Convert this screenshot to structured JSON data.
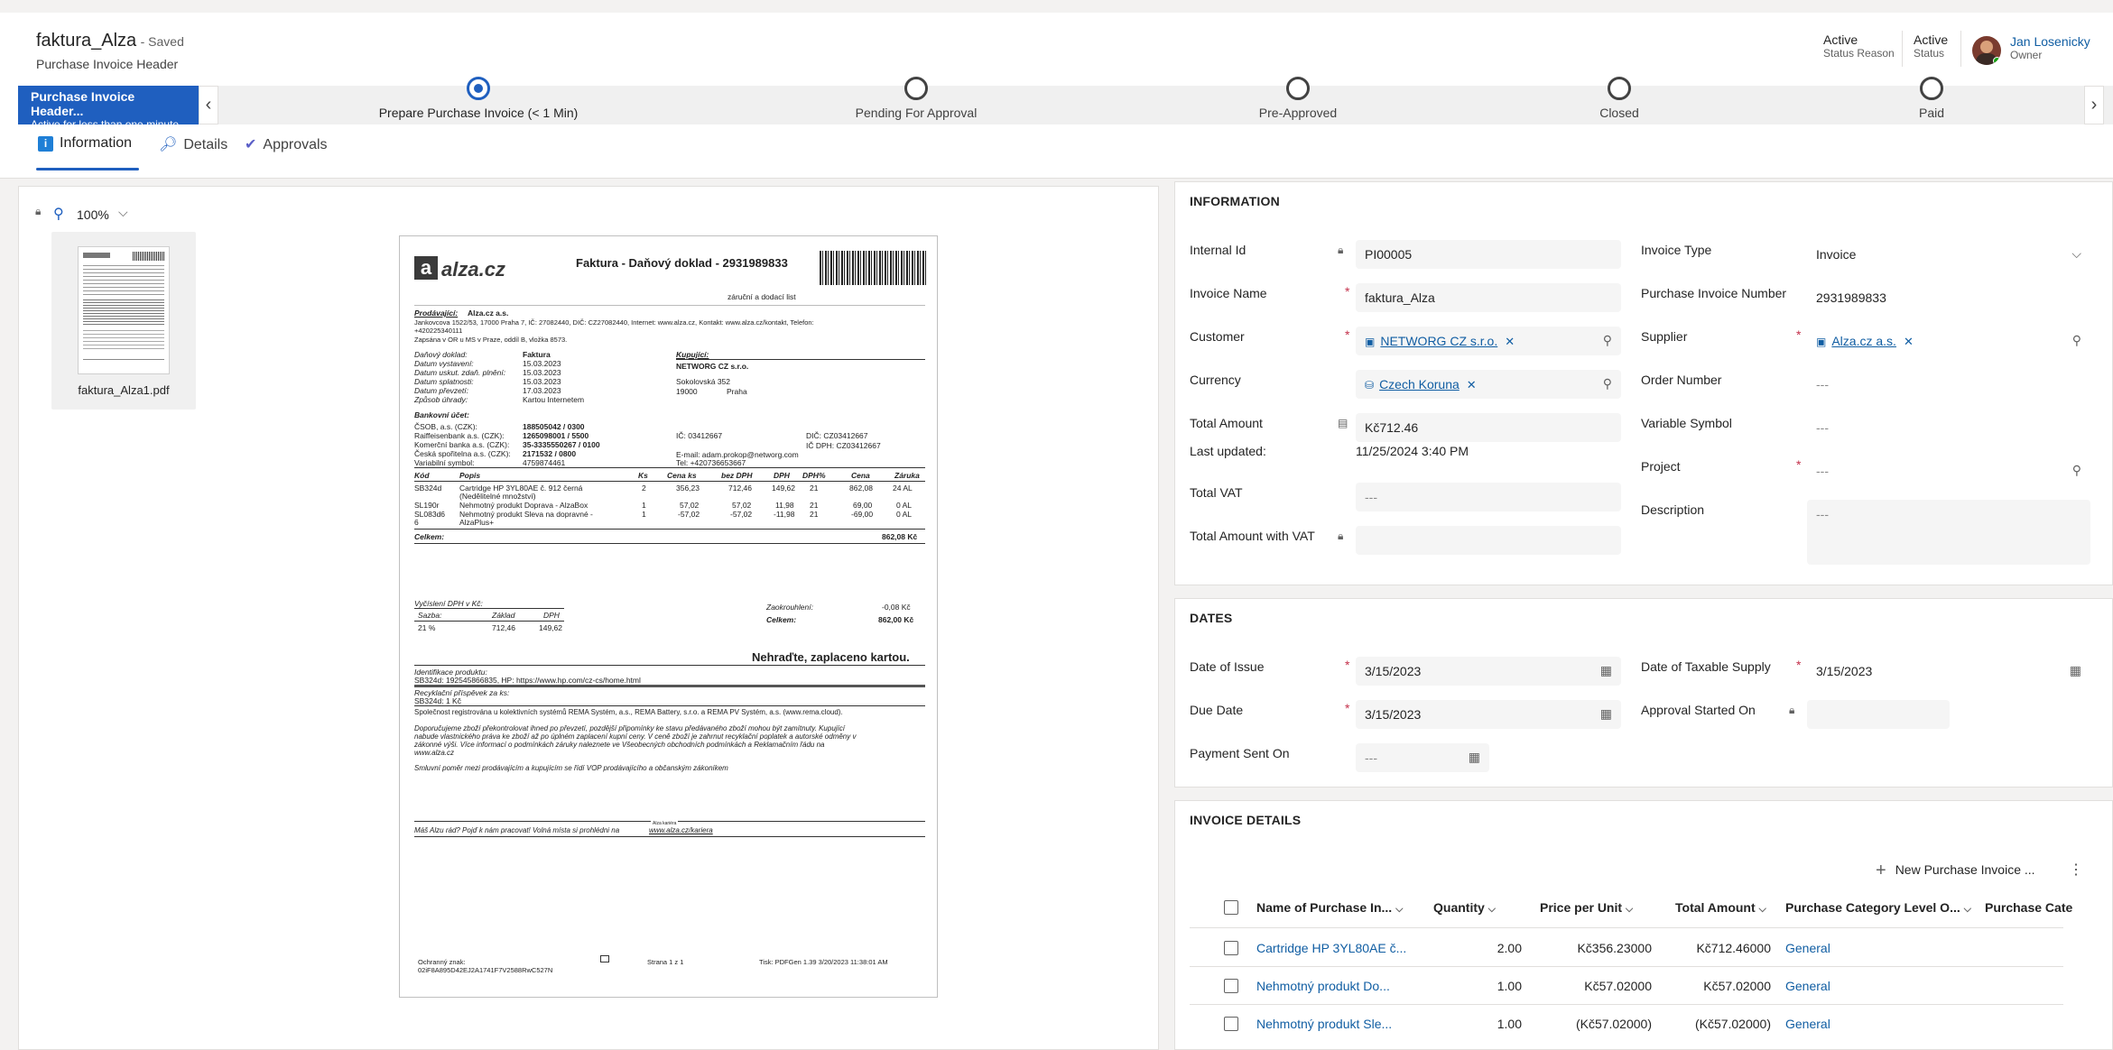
{
  "header": {
    "title": "faktura_Alza",
    "saved": "- Saved",
    "entity": "Purchase Invoice Header",
    "status_reason_value": "Active",
    "status_reason_label": "Status Reason",
    "status_value": "Active",
    "status_label": "Status",
    "owner_name": "Jan Losenicky",
    "owner_label": "Owner"
  },
  "bpf": {
    "active_title": "Purchase Invoice Header...",
    "active_sub": "Active for less than one minute",
    "stages": [
      "Prepare Purchase Invoice  (< 1 Min)",
      "Pending For Approval",
      "Pre-Approved",
      "Closed",
      "Paid"
    ]
  },
  "tabs": [
    "Information",
    "Details",
    "Approvals"
  ],
  "viewer": {
    "zoom": "100%",
    "file_name": "faktura_Alza1.pdf"
  },
  "document": {
    "logo": "alza.cz",
    "heading": "Faktura - Daňový doklad - 2931989833",
    "subheading": "záruční a dodací list",
    "seller_label": "Prodávající:",
    "seller_name": "Alza.cz a.s.",
    "seller_addr": "Jankovcova 1522/53, 17000 Praha 7, IČ: 27082440, DIČ: CZ27082440, Internet: www.alza.cz, Kontakt: www.alza.cz/kontakt, Telefon:",
    "seller_phone": "+420225340111",
    "seller_reg": "Zapsána v OR u MS v Praze, oddíl B, vložka 8573.",
    "tax_doc_label": "Daňový doklad:",
    "tax_doc_value": "Faktura",
    "date_issue_label": "Datum vystavení:",
    "date_issue_value": "15.03.2023",
    "date_tax_label": "Datum uskut. zdaň. plnění:",
    "date_tax_value": "15.03.2023",
    "date_due_label": "Datum splatnosti:",
    "date_due_value": "15.03.2023",
    "date_take_label": "Datum převzetí:",
    "date_take_value": "17.03.2023",
    "pay_label": "Způsob úhrady:",
    "pay_value": "Kartou Internetem",
    "buyer_label": "Kupující:",
    "buyer_name": "NETWORG CZ s.r.o.",
    "buyer_street": "Sokolovská 352",
    "buyer_zip": "19000",
    "buyer_city": "Praha",
    "bank_label": "Bankovní účet:",
    "bank1_label": "ČSOB, a.s. (CZK):",
    "bank1_value": "188505042 / 0300",
    "bank2_label": "Raiffeisenbank a.s. (CZK):",
    "bank2_value": "1265098001 / 5500",
    "bank3_label": "Komerční banka a.s. (CZK):",
    "bank3_value": "35-3335550267 / 0100",
    "bank4_label": "Česká spořitelna a.s. (CZK):",
    "bank4_value": "2171532 / 0800",
    "vs_label": "Variabilní symbol:",
    "vs_value": "4759874461",
    "buyer_ic": "IČ: 03412667",
    "buyer_dic": "DIČ: CZ03412667",
    "buyer_icdph": "IČ DPH: CZ03412667",
    "buyer_email": "E-mail: adam.prokop@networg.com",
    "buyer_tel": "Tel: +420736653667",
    "cols": [
      "Kód",
      "Popis",
      "Ks",
      "Cena ks",
      "bez DPH",
      "DPH",
      "DPH%",
      "Cena",
      "Záruka"
    ],
    "rows": [
      [
        "SB324d",
        "Cartridge HP 3YL80AE č. 912 černá",
        "2",
        "356,23",
        "712,46",
        "149,62",
        "21",
        "862,08",
        "24 AL"
      ],
      [
        "",
        "(Nedělitelné množství)",
        "",
        "",
        "",
        "",
        "",
        "",
        ""
      ],
      [
        "SL190r",
        "Nehmotný produkt Doprava - AlzaBox",
        "1",
        "57,02",
        "57,02",
        "11,98",
        "21",
        "69,00",
        "0 AL"
      ],
      [
        "SL083d6",
        "Nehmotný produkt Sleva na dopravné -",
        "1",
        "-57,02",
        "-57,02",
        "-11,98",
        "21",
        "-69,00",
        "0 AL"
      ],
      [
        "6",
        "AlzaPlus+",
        "",
        "",
        "",
        "",
        "",
        "",
        ""
      ]
    ],
    "total_label": "Celkem:",
    "total_value": "862,08  Kč",
    "vat_title": "Vyčíslení DPH v Kč:",
    "vat_cols": [
      "Sazba:",
      "Základ",
      "DPH"
    ],
    "vat_row": [
      "21 %",
      "712,46",
      "149,62"
    ],
    "round_label": "Zaokrouhlení:",
    "round_value": "-0,08  Kč",
    "sum_label": "Celkem:",
    "sum_value": "862,00  Kč",
    "paid_note": "Nehraďte, zaplaceno kartou.",
    "prod_id_label": "Identifikace produktu:",
    "prod_id_value": "SB324d: 192545866835, HP: https://www.hp.com/cz-cs/home.html",
    "recycle_label": "Recyklační příspěvek za ks:",
    "recycle_value": "SB324d:              1 Kč",
    "rema": "Společnost registrována u kolektivních systémů REMA Systém, a.s., REMA Battery, s.r.o. a REMA PV Systém, a.s. (www.rema.cloud).",
    "advice1": "Doporučujeme zboží překontrolovat ihned po převzetí, pozdější připomínky ke stavu předávaného zboží mohou být zamítnuty. Kupující",
    "advice2": "nabude vlastnického práva ke zboží až po úplném zaplacení kupní ceny. V ceně zboží je zahrnut recyklační poplatek a autorské odměny v",
    "advice3": "zákonné výši. Více informací o podmínkách záruky naleznete ve Všeobecných obchodních podmínkách a Reklamačním řádu na",
    "advice4": "www.alza.cz",
    "contract": "Smluvní poměr mezi prodávajícím a kupujícím se řídí VOP prodávajícího a občanským zákoníkem",
    "career_small": "Alza kariéra",
    "career": "Máš Alzu rád? Pojď k nám pracovat! Volná místa si prohlédni na",
    "career_link": "www.alza.cz/kariera",
    "stamp_label": "Ochranný znak:",
    "stamp_value": "02iF8A895D42EJ2A1741F7V2588RwC527N",
    "page": "Strana 1 z 1",
    "printed": "Tisk: PDFGen 1.39  3/20/2023 11:38:01 AM"
  },
  "information": {
    "title": "INFORMATION",
    "internal_id_label": "Internal Id",
    "internal_id": "PI00005",
    "invoice_name_label": "Invoice Name",
    "invoice_name": "faktura_Alza",
    "customer_label": "Customer",
    "customer": "NETWORG CZ s.r.o.",
    "currency_label": "Currency",
    "currency": "Czech Koruna",
    "total_amount_label": "Total Amount",
    "total_amount": "Kč712.46",
    "last_updated_label": "Last updated:",
    "last_updated": "11/25/2024 3:40 PM",
    "total_vat_label": "Total VAT",
    "total_vat": "---",
    "total_with_vat_label": "Total Amount with VAT",
    "total_with_vat": "",
    "invoice_type_label": "Invoice Type",
    "invoice_type": "Invoice",
    "pin_label": "Purchase Invoice Number",
    "pin": "2931989833",
    "supplier_label": "Supplier",
    "supplier": "Alza.cz a.s.",
    "order_label": "Order Number",
    "order": "---",
    "vs_label": "Variable Symbol",
    "vs": "---",
    "project_label": "Project",
    "project": "---",
    "desc_label": "Description",
    "desc": "---"
  },
  "dates": {
    "title": "DATES",
    "issue_label": "Date of Issue",
    "issue": "3/15/2023",
    "due_label": "Due Date",
    "due": "3/15/2023",
    "sent_label": "Payment Sent On",
    "sent": "---",
    "taxable_label": "Date of Taxable Supply",
    "taxable": "3/15/2023",
    "approval_label": "Approval Started On",
    "approval": ""
  },
  "details": {
    "title": "INVOICE DETAILS",
    "new_btn": "New Purchase Invoice ...",
    "cols": [
      "Name of Purchase In...",
      "Quantity",
      "Price per Unit",
      "Total Amount",
      "Purchase Category Level O...",
      "Purchase Cate"
    ],
    "rows": [
      {
        "name": "Cartridge HP 3YL80AE č...",
        "qty": "2.00",
        "ppu": "Kč356.23000",
        "total": "Kč712.46000",
        "cat": "General"
      },
      {
        "name": "Nehmotný produkt Do...",
        "qty": "1.00",
        "ppu": "Kč57.02000",
        "total": "Kč57.02000",
        "cat": "General"
      },
      {
        "name": "Nehmotný produkt Sle...",
        "qty": "1.00",
        "ppu": "(Kč57.02000)",
        "total": "(Kč57.02000)",
        "cat": "General"
      }
    ]
  }
}
